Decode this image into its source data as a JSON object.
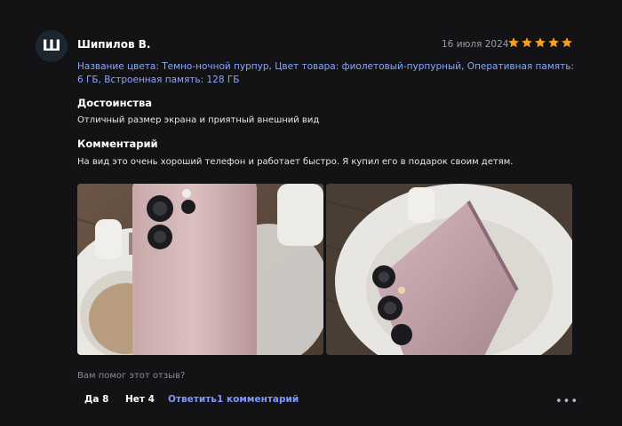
{
  "review": {
    "avatar_letter": "Ш",
    "author": "Шипилов В.",
    "date": "16 июля 2024",
    "rating": 5,
    "specs": "Название цвета: Темно-ночной пурпур, Цвет товара: фиолетовый-пурпурный, Оперативная память: 6 ГБ, Встроенная память: 128 ГБ",
    "pros_heading": "Достоинства",
    "pros_text": "Отличный размер экрана и приятный внешний вид",
    "comment_heading": "Комментарий",
    "comment_text": "На вид это очень хороший телефон и работает быстро. Я купил его в подарок своим детям."
  },
  "footer": {
    "helpful_question": "Вам помог этот отзыв?",
    "yes_label": "Да 8",
    "no_label": "Нет 4",
    "reply_label": "Ответить",
    "comments_label": "1 комментарий"
  },
  "colors": {
    "background": "#131316",
    "link": "#8aa7ff",
    "star": "#f7a11a"
  },
  "icons": {
    "rating": "star-icon",
    "menu": "more-dots-icon"
  }
}
